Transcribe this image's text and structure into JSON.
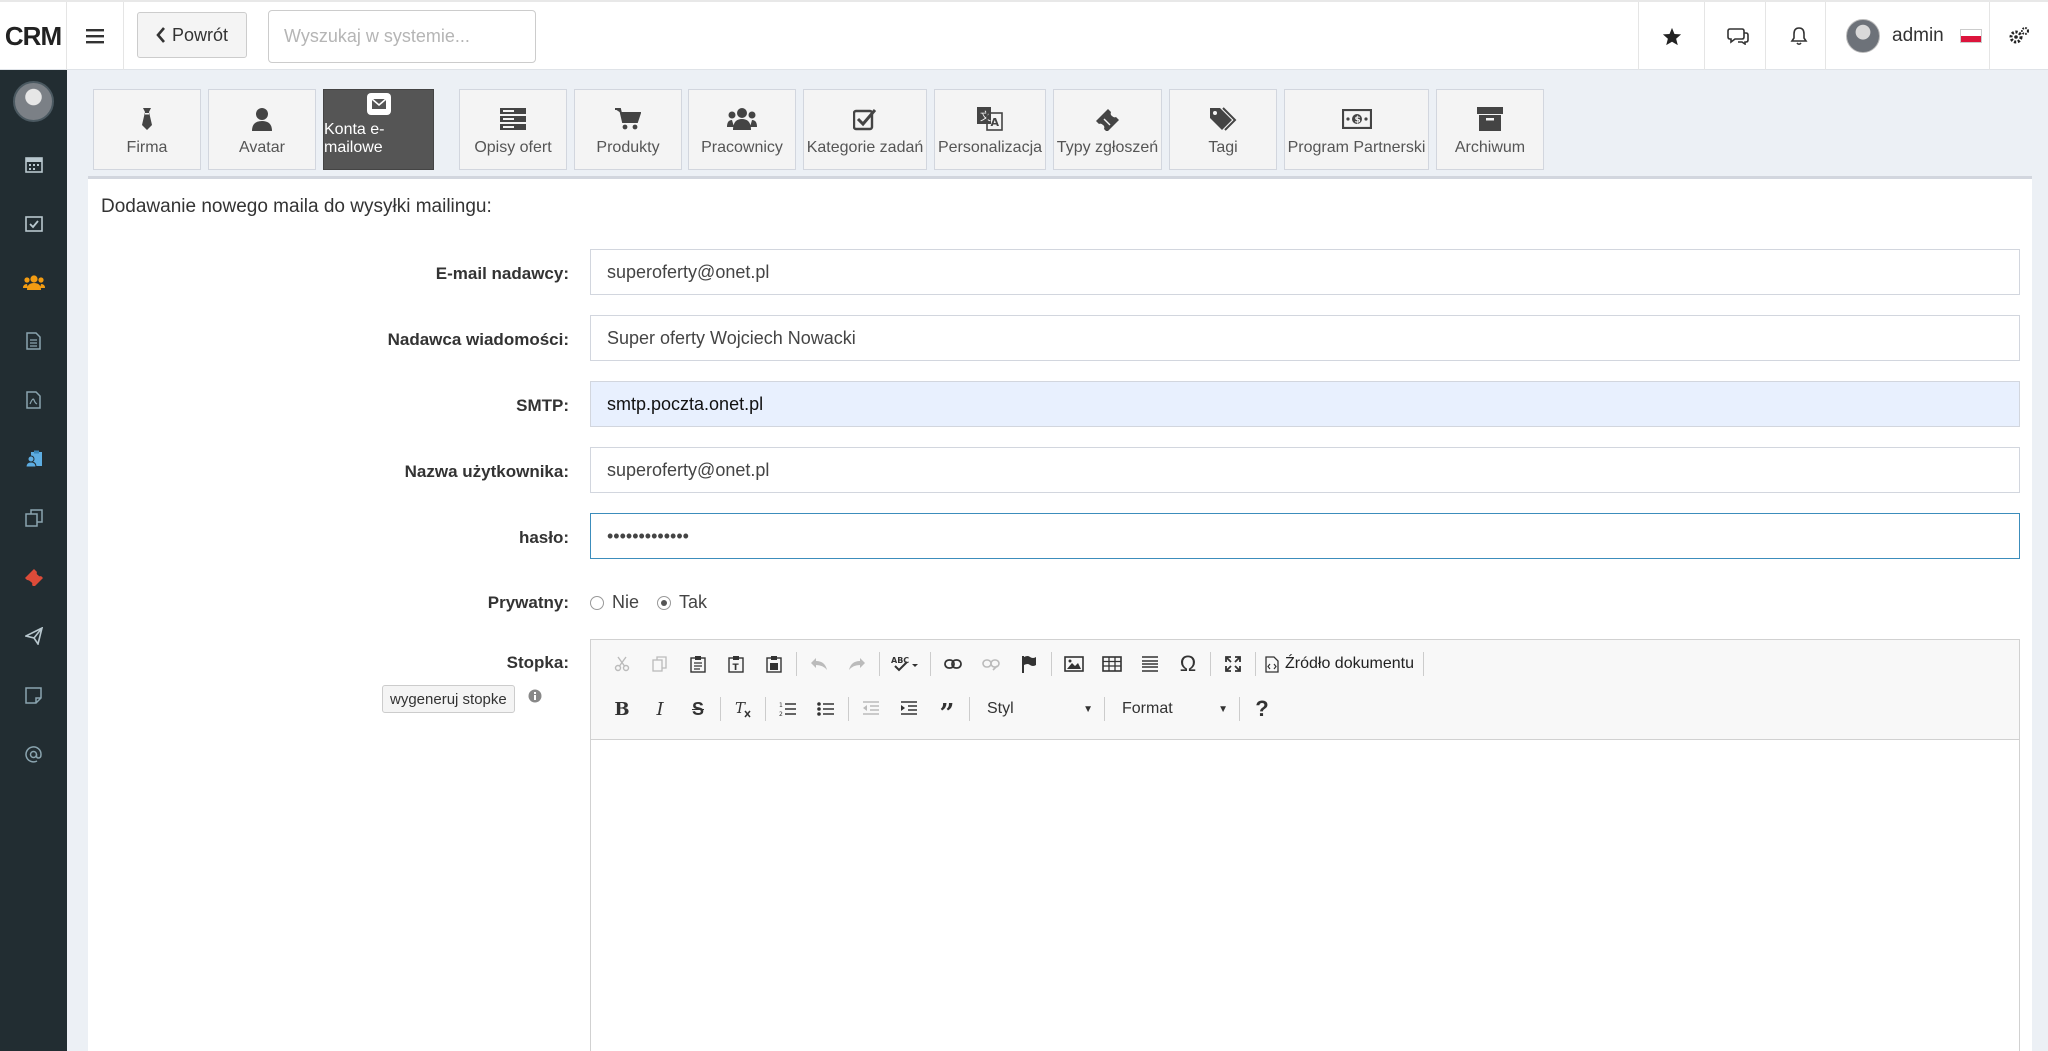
{
  "app": {
    "logo": "CRM"
  },
  "header": {
    "back_label": "Powrót",
    "search_placeholder": "Wyszukaj w systemie...",
    "user_name": "admin"
  },
  "tabs": [
    {
      "label": "Firma",
      "icon": "tie-icon"
    },
    {
      "label": "Avatar",
      "icon": "user-icon"
    },
    {
      "label": "Konta e-mailowe",
      "icon": "envelope-icon",
      "active": true
    },
    {
      "label": "Opisy ofert",
      "icon": "server-icon"
    },
    {
      "label": "Produkty",
      "icon": "cart-icon"
    },
    {
      "label": "Pracownicy",
      "icon": "users-icon"
    },
    {
      "label": "Kategorie zadań",
      "icon": "check-square-icon"
    },
    {
      "label": "Personalizacja",
      "icon": "translate-icon"
    },
    {
      "label": "Typy zgłoszeń",
      "icon": "ticket-icon"
    },
    {
      "label": "Tagi",
      "icon": "tags-icon"
    },
    {
      "label": "Program Partnerski",
      "icon": "money-icon"
    },
    {
      "label": "Archiwum",
      "icon": "archive-icon"
    }
  ],
  "form": {
    "title": "Dodawanie nowego maila do wysyłki mailingu:",
    "sender_email_label": "E-mail nadawcy:",
    "sender_email_value": "superoferty@onet.pl",
    "sender_name_label": "Nadawca wiadomości:",
    "sender_name_value": "Super oferty Wojciech Nowacki",
    "smtp_label": "SMTP:",
    "smtp_value": "smtp.poczta.onet.pl",
    "username_label": "Nazwa użytkownika:",
    "username_value": "superoferty@onet.pl",
    "password_label": "hasło:",
    "password_value": "•••••••••••••",
    "private_label": "Prywatny:",
    "private_no": "Nie",
    "private_yes": "Tak",
    "private_selected": "Tak",
    "footer_label": "Stopka:",
    "generate_footer_button": "wygeneruj stopke"
  },
  "editor": {
    "source_label": "Źródło dokumentu",
    "style_combo": "Styl",
    "format_combo": "Format"
  },
  "colors": {
    "sidebar_bg": "#222d32",
    "active_tab_bg": "#555555",
    "accent_orange": "#f39c12",
    "accent_red": "#dd4b39",
    "autofill_bg": "#e8f0fe"
  }
}
